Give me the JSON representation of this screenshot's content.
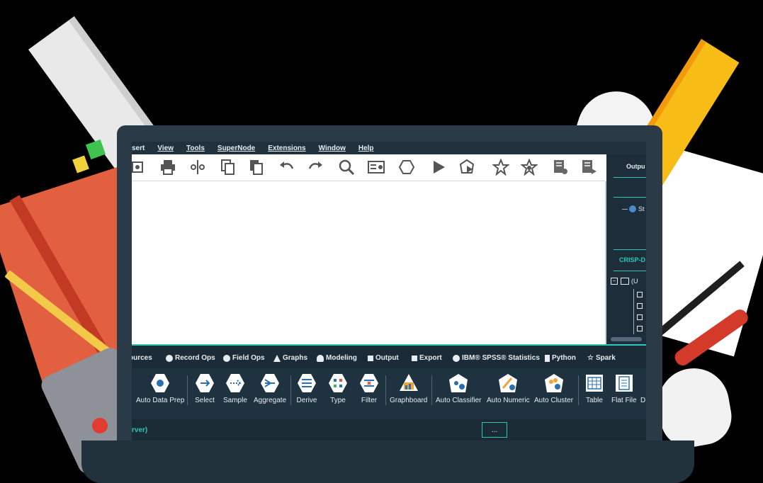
{
  "menubar": {
    "items": [
      "sert",
      "View",
      "Tools",
      "SuperNode",
      "Extensions",
      "Window",
      "Help"
    ]
  },
  "toolbar": {
    "icons": [
      "open-icon",
      "print-icon",
      "cut-icon",
      "copy-icon",
      "paste-icon",
      "undo-icon",
      "redo-icon",
      "search-icon",
      "properties-icon",
      "supernode-icon",
      "run-icon",
      "run-selection-icon",
      "favorite-icon",
      "star-node-icon",
      "report-icon",
      "export-report-icon"
    ]
  },
  "right_panel": {
    "output_title": "Outpu",
    "stream_item": "St",
    "crisp_title": "CRISP-D",
    "tree_root": "(U"
  },
  "palette": {
    "tabs": [
      "ources",
      "Record Ops",
      "Field Ops",
      "Graphs",
      "Modeling",
      "Output",
      "Export",
      "IBM® SPSS® Statistics",
      "Python",
      "Spark"
    ]
  },
  "nodes": [
    "Auto Data Prep",
    "Select",
    "Sample",
    "Aggregate",
    "Derive",
    "Type",
    "Filter",
    "Graphboard",
    "Auto Classifier",
    "Auto Numeric",
    "Auto Cluster",
    "Table",
    "Flat File",
    "D"
  ],
  "status": {
    "server_text": "rver)",
    "button_label": "..."
  },
  "colors": {
    "accent": "#2bc7b7",
    "panel_dark": "#1f3240",
    "menubar": "#21313d"
  }
}
